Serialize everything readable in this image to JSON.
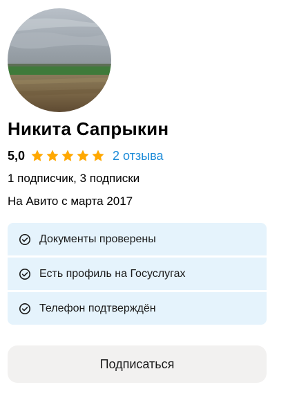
{
  "profile": {
    "avatar_icon": "landscape-photo",
    "name": "Никита Сапрыкин",
    "rating": "5,0",
    "stars": 5,
    "reviews_label": "2 отзыва",
    "subscriptions": "1 подписчик, 3 подписки",
    "member_since": "На Авито с марта 2017"
  },
  "verifications": [
    {
      "icon": "check-circle-icon",
      "label": "Документы проверены"
    },
    {
      "icon": "check-circle-icon",
      "label": "Есть профиль на Госуслугах"
    },
    {
      "icon": "check-circle-icon",
      "label": "Телефон подтверждён"
    }
  ],
  "actions": {
    "subscribe_label": "Подписаться"
  },
  "colors": {
    "star": "#ffa800",
    "link": "#1a8ad8",
    "badge_bg": "#e5f3fc",
    "button_bg": "#f2f1f0"
  }
}
